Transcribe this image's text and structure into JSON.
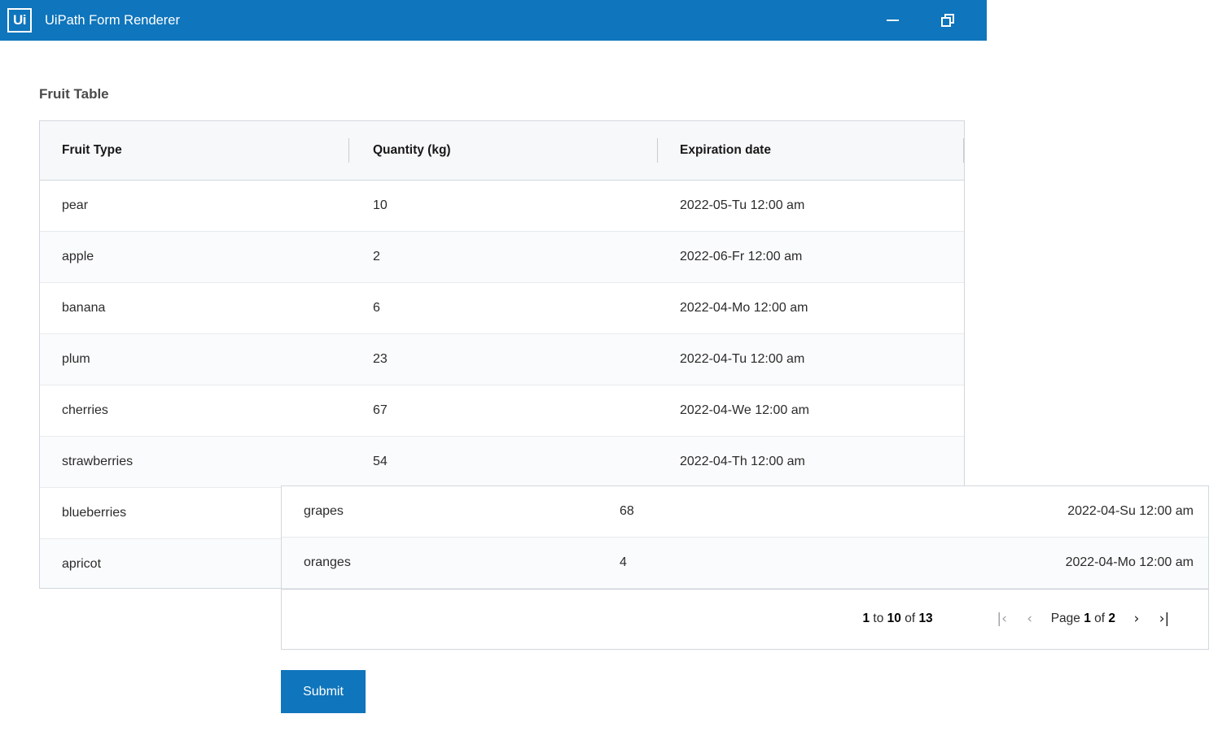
{
  "window": {
    "title": "UiPath Form Renderer",
    "logo_text": "Ui",
    "logo_icon": "uipath-logo-icon",
    "minimize_icon": "minimize-icon",
    "restore_icon": "restore-icon",
    "accent_color": "#0f75bc"
  },
  "form": {
    "title": "Fruit Table",
    "submit_label": "Submit"
  },
  "grid": {
    "columns": [
      "Fruit Type",
      "Quantity (kg)",
      "Expiration date"
    ],
    "rows": [
      {
        "fruit": "pear",
        "quantity": "10",
        "expiration": "2022-05-Tu 12:00 am"
      },
      {
        "fruit": "apple",
        "quantity": "2",
        "expiration": "2022-06-Fr 12:00 am"
      },
      {
        "fruit": "banana",
        "quantity": "6",
        "expiration": "2022-04-Mo 12:00 am"
      },
      {
        "fruit": "plum",
        "quantity": "23",
        "expiration": "2022-04-Tu 12:00 am"
      },
      {
        "fruit": "cherries",
        "quantity": "67",
        "expiration": "2022-04-We 12:00 am"
      },
      {
        "fruit": "strawberries",
        "quantity": "54",
        "expiration": "2022-04-Th 12:00 am"
      },
      {
        "fruit": "blueberries",
        "quantity": "",
        "expiration": ""
      },
      {
        "fruit": "apricot",
        "quantity": "",
        "expiration": ""
      }
    ]
  },
  "overlay_grid": {
    "rows": [
      {
        "fruit": "grapes",
        "quantity": "68",
        "expiration": "2022-04-Su 12:00 am"
      },
      {
        "fruit": "oranges",
        "quantity": "4",
        "expiration": "2022-04-Mo 12:00 am"
      }
    ],
    "pager": {
      "range_from": "1",
      "range_to_label": " to ",
      "range_to": "10",
      "range_of_label": " of ",
      "range_total": "13",
      "page_label": "Page ",
      "page_current": "1",
      "page_of_label": " of ",
      "page_total": "2",
      "first_icon": "first-page-icon",
      "prev_icon": "previous-page-icon",
      "next_icon": "next-page-icon",
      "last_icon": "last-page-icon",
      "first_glyph": "|‹",
      "prev_glyph": "‹",
      "next_glyph": "›",
      "last_glyph": "›|"
    }
  }
}
